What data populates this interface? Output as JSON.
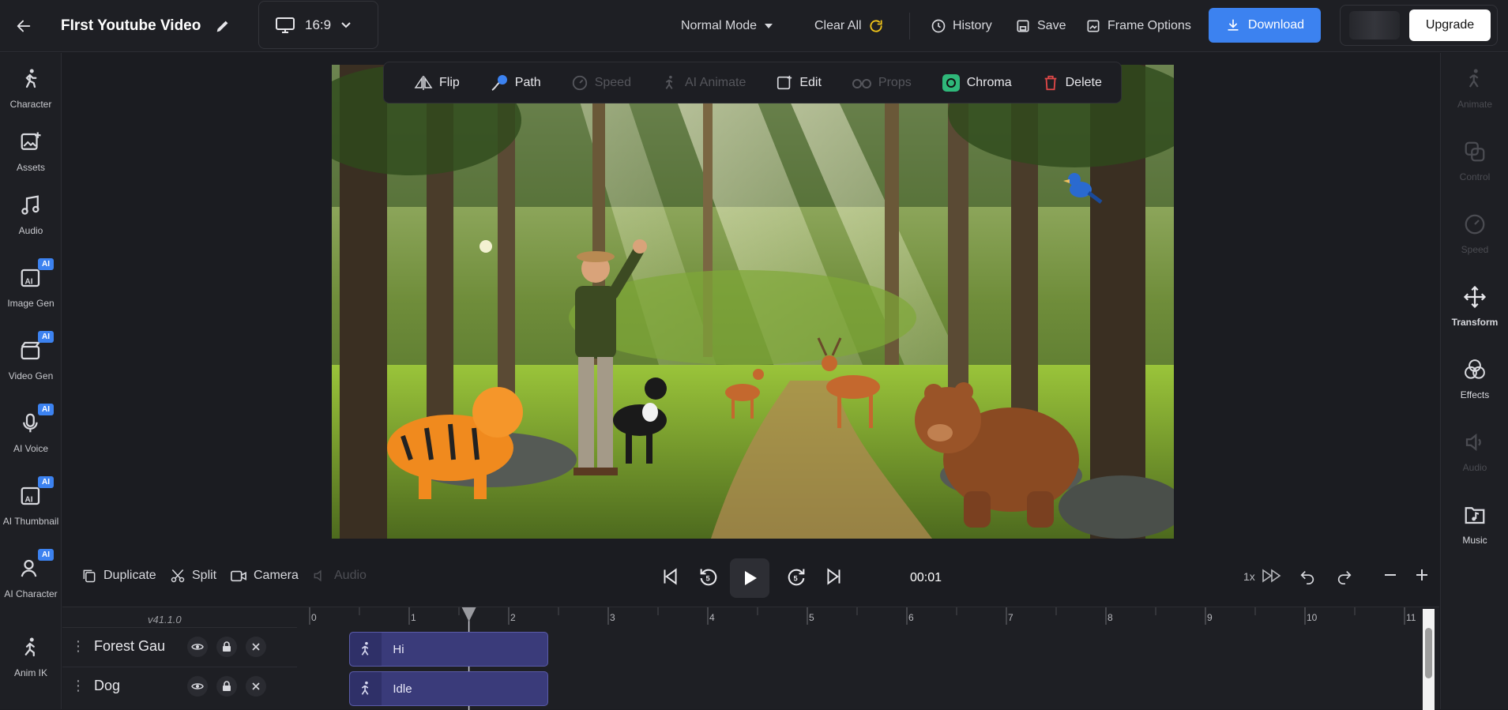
{
  "header": {
    "project_title": "FIrst Youtube Video",
    "aspect_ratio": "16:9",
    "mode": "Normal Mode",
    "clear_all": "Clear All",
    "history": "History",
    "save": "Save",
    "frame_options": "Frame Options",
    "download": "Download",
    "upgrade": "Upgrade"
  },
  "left_sidebar": {
    "items": [
      {
        "label": "Character",
        "icon": "character-icon",
        "ai": false
      },
      {
        "label": "Assets",
        "icon": "image-plus-icon",
        "ai": false
      },
      {
        "label": "Audio",
        "icon": "music-note-icon",
        "ai": false
      },
      {
        "label": "Image Gen",
        "icon": "ai-image-icon",
        "ai": true
      },
      {
        "label": "Video Gen",
        "icon": "ai-clapper-icon",
        "ai": true
      },
      {
        "label": "AI Voice",
        "icon": "ai-mic-icon",
        "ai": true
      },
      {
        "label": "AI Thumbnail",
        "icon": "ai-thumbnail-icon",
        "ai": true
      },
      {
        "label": "AI Character",
        "icon": "ai-character-icon",
        "ai": true
      },
      {
        "label": "Anim IK",
        "icon": "anim-ik-icon",
        "ai": false
      }
    ],
    "ai_badge": "AI"
  },
  "right_sidebar": {
    "items": [
      {
        "label": "Animate",
        "enabled": false
      },
      {
        "label": "Control",
        "enabled": false
      },
      {
        "label": "Speed",
        "enabled": false
      },
      {
        "label": "Transform",
        "enabled": true
      },
      {
        "label": "Effects",
        "enabled": true
      },
      {
        "label": "Audio",
        "enabled": false
      },
      {
        "label": "Music",
        "enabled": true
      }
    ]
  },
  "object_toolbar": {
    "flip": "Flip",
    "path": "Path",
    "speed": "Speed",
    "ai_animate": "AI Animate",
    "edit": "Edit",
    "props": "Props",
    "chroma": "Chroma",
    "delete": "Delete"
  },
  "playback": {
    "duplicate": "Duplicate",
    "split": "Split",
    "camera": "Camera",
    "audio": "Audio",
    "current_time": "00:01",
    "speed": "1x"
  },
  "timeline": {
    "version": "v41.1.0",
    "ruler_labels": [
      "0",
      "1",
      "2",
      "3",
      "4",
      "5",
      "6",
      "7",
      "8",
      "9",
      "10",
      "11"
    ],
    "playhead_seconds": 1.6,
    "tracks": [
      {
        "name": "Forest Gau",
        "clip_label": "Hi",
        "clip_start": 0.4,
        "clip_end": 2.4
      },
      {
        "name": "Dog",
        "clip_label": "Idle",
        "clip_start": 0.4,
        "clip_end": 2.4
      }
    ]
  },
  "colors": {
    "accent": "#3c82f0",
    "bg": "#1b1c21",
    "clip": "#3a3b7a",
    "annotation_arrow": "#e02020"
  }
}
